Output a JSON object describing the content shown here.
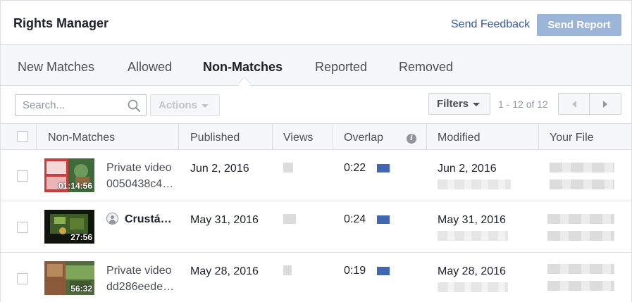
{
  "header": {
    "title": "Rights Manager",
    "feedback_label": "Send Feedback",
    "send_report_label": "Send Report"
  },
  "tabs": [
    {
      "label": "New Matches"
    },
    {
      "label": "Allowed"
    },
    {
      "label": "Non-Matches",
      "active": true
    },
    {
      "label": "Reported"
    },
    {
      "label": "Removed"
    }
  ],
  "toolbar": {
    "search_placeholder": "Search...",
    "actions_label": "Actions",
    "filters_label": "Filters",
    "pager_text": "1 - 12 of 12"
  },
  "columns": {
    "non_matches": "Non-Matches",
    "published": "Published",
    "views": "Views",
    "overlap": "Overlap",
    "modified": "Modified",
    "your_file": "Your File"
  },
  "rows": [
    {
      "duration": "01:14:56",
      "title": "Private video",
      "subtitle": "0050438c4…",
      "published": "Jun 2, 2016",
      "overlap": "0:22",
      "modified": "Jun 2, 2016"
    },
    {
      "duration": "27:56",
      "title": "Crustá…",
      "subtitle": "",
      "published": "May 31, 2016",
      "overlap": "0:24",
      "modified": "May 31, 2016"
    },
    {
      "duration": "56:32",
      "title": "Private video",
      "subtitle": "dd286eede…",
      "published": "May 28, 2016",
      "overlap": "0:19",
      "modified": "May 28, 2016"
    }
  ],
  "colors": {
    "accent": "#365899",
    "overlap_bar": "#4267b2",
    "send_report_bg": "#9cb4d8"
  },
  "icons": {
    "search": "search-icon",
    "info": "info-icon",
    "prev": "chevron-left-icon",
    "next": "chevron-right-icon",
    "profile": "person-icon"
  }
}
